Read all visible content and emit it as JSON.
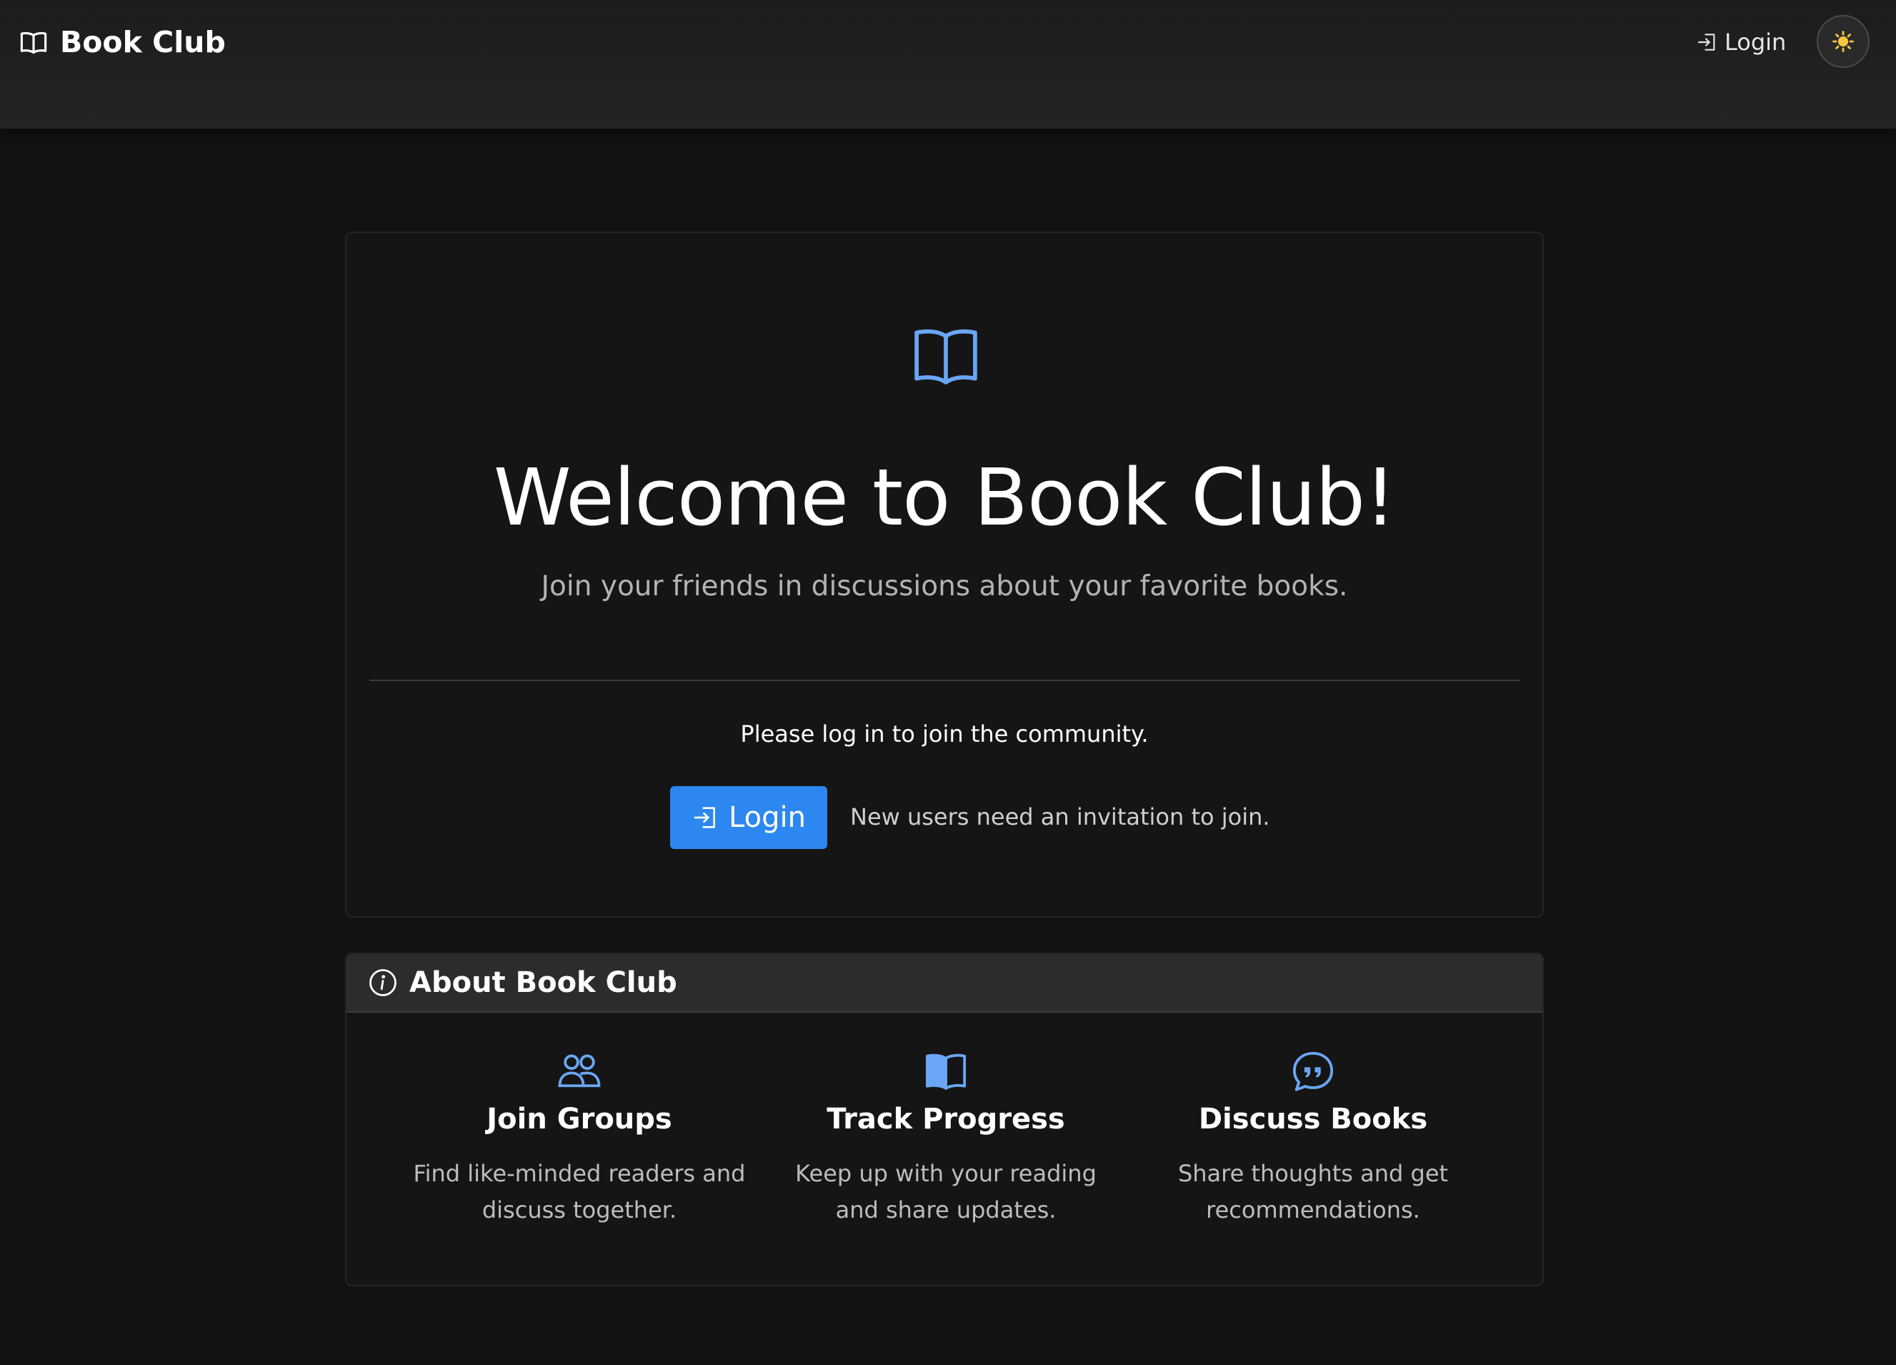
{
  "app": {
    "brand": "Book Club",
    "accent_color": "#2c87f0",
    "icon_color": "#6aa6f5"
  },
  "navbar": {
    "login_label": "Login",
    "theme_toggle_icon": "sun-icon"
  },
  "hero": {
    "icon": "open-book-icon",
    "title": "Welcome to Book Club!",
    "subtitle": "Join your friends in discussions about your favorite books.",
    "prompt": "Please log in to join the community.",
    "login_button_label": "Login",
    "invite_note": "New users need an invitation to join."
  },
  "about": {
    "heading": "About Book Club",
    "features": [
      {
        "icon": "people-icon",
        "title": "Join Groups",
        "description": "Find like-minded readers and discuss together."
      },
      {
        "icon": "book-icon",
        "title": "Track Progress",
        "description": "Keep up with your reading and share updates."
      },
      {
        "icon": "quote-chat-icon",
        "title": "Discuss Books",
        "description": "Share thoughts and get recommendations."
      }
    ]
  }
}
